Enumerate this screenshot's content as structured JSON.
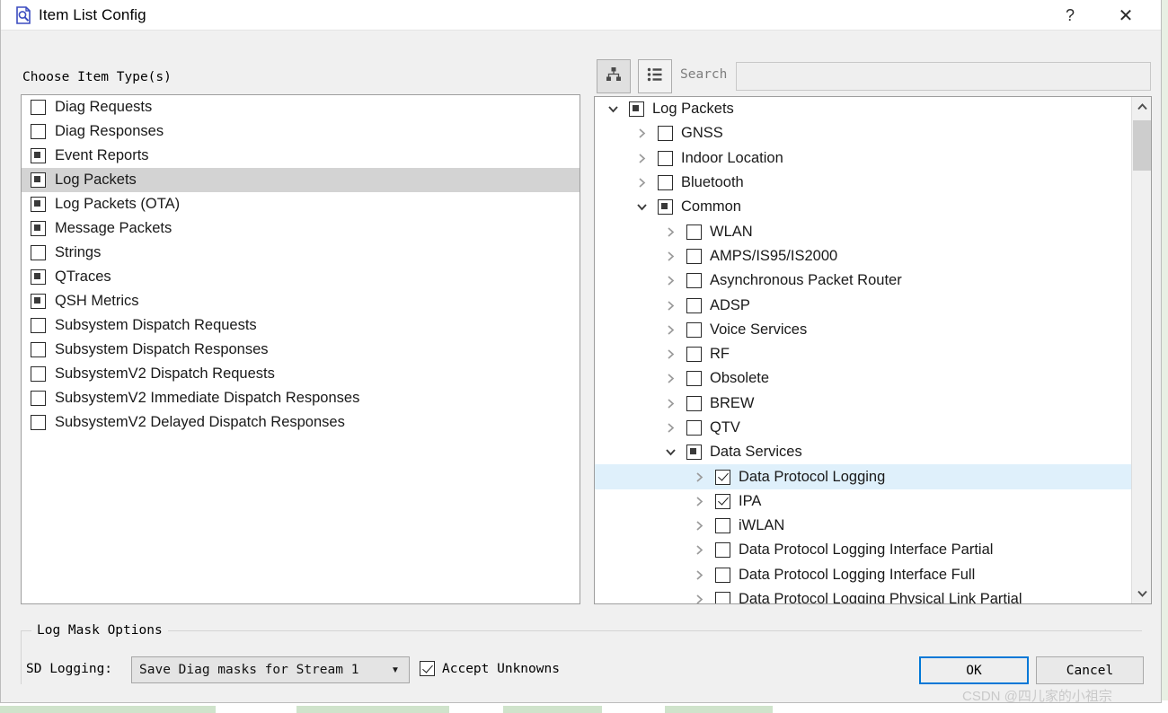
{
  "window": {
    "title": "Item List Config",
    "icon": "document-search-icon",
    "help_label": "?",
    "close_label": "✕"
  },
  "left_panel": {
    "group_label": "Choose Item Type(s)",
    "items": [
      {
        "label": "Diag Requests",
        "state": "unchecked",
        "selected": false
      },
      {
        "label": "Diag Responses",
        "state": "unchecked",
        "selected": false
      },
      {
        "label": "Event Reports",
        "state": "partial",
        "selected": false
      },
      {
        "label": "Log Packets",
        "state": "partial",
        "selected": true
      },
      {
        "label": "Log Packets (OTA)",
        "state": "partial",
        "selected": false
      },
      {
        "label": "Message Packets",
        "state": "partial",
        "selected": false
      },
      {
        "label": "Strings",
        "state": "unchecked",
        "selected": false
      },
      {
        "label": "QTraces",
        "state": "partial",
        "selected": false
      },
      {
        "label": "QSH Metrics",
        "state": "partial",
        "selected": false
      },
      {
        "label": "Subsystem Dispatch Requests",
        "state": "unchecked",
        "selected": false
      },
      {
        "label": "Subsystem Dispatch Responses",
        "state": "unchecked",
        "selected": false
      },
      {
        "label": "SubsystemV2 Dispatch Requests",
        "state": "unchecked",
        "selected": false
      },
      {
        "label": "SubsystemV2 Immediate Dispatch Responses",
        "state": "unchecked",
        "selected": false
      },
      {
        "label": "SubsystemV2 Delayed Dispatch Responses",
        "state": "unchecked",
        "selected": false
      }
    ]
  },
  "right_panel": {
    "toolbar": {
      "tree_view_icon": "hierarchy-icon",
      "list_view_icon": "bulleted-list-icon",
      "search_label": "Search",
      "search_value": "",
      "search_placeholder": ""
    },
    "tree": [
      {
        "label": "Log Packets",
        "state": "partial",
        "depth": 0,
        "expander": "open",
        "selected": false
      },
      {
        "label": "GNSS",
        "state": "unchecked",
        "depth": 1,
        "expander": "closed",
        "selected": false
      },
      {
        "label": "Indoor Location",
        "state": "unchecked",
        "depth": 1,
        "expander": "closed",
        "selected": false
      },
      {
        "label": "Bluetooth",
        "state": "unchecked",
        "depth": 1,
        "expander": "closed",
        "selected": false
      },
      {
        "label": "Common",
        "state": "partial",
        "depth": 1,
        "expander": "open",
        "selected": false
      },
      {
        "label": "WLAN",
        "state": "unchecked",
        "depth": 2,
        "expander": "closed",
        "selected": false
      },
      {
        "label": "AMPS/IS95/IS2000",
        "state": "unchecked",
        "depth": 2,
        "expander": "closed",
        "selected": false
      },
      {
        "label": "Asynchronous Packet Router",
        "state": "unchecked",
        "depth": 2,
        "expander": "closed",
        "selected": false
      },
      {
        "label": "ADSP",
        "state": "unchecked",
        "depth": 2,
        "expander": "closed",
        "selected": false
      },
      {
        "label": "Voice Services",
        "state": "unchecked",
        "depth": 2,
        "expander": "closed",
        "selected": false
      },
      {
        "label": "RF",
        "state": "unchecked",
        "depth": 2,
        "expander": "closed",
        "selected": false
      },
      {
        "label": "Obsolete",
        "state": "unchecked",
        "depth": 2,
        "expander": "closed",
        "selected": false
      },
      {
        "label": "BREW",
        "state": "unchecked",
        "depth": 2,
        "expander": "closed",
        "selected": false
      },
      {
        "label": "QTV",
        "state": "unchecked",
        "depth": 2,
        "expander": "closed",
        "selected": false
      },
      {
        "label": "Data Services",
        "state": "partial",
        "depth": 2,
        "expander": "open",
        "selected": false
      },
      {
        "label": "Data Protocol Logging",
        "state": "checked",
        "depth": 3,
        "expander": "closed",
        "selected": true
      },
      {
        "label": "IPA",
        "state": "checked",
        "depth": 3,
        "expander": "closed",
        "selected": false
      },
      {
        "label": "iWLAN",
        "state": "unchecked",
        "depth": 3,
        "expander": "closed",
        "selected": false
      },
      {
        "label": "Data Protocol Logging Interface Partial",
        "state": "unchecked",
        "depth": 3,
        "expander": "closed",
        "selected": false
      },
      {
        "label": "Data Protocol Logging Interface Full",
        "state": "unchecked",
        "depth": 3,
        "expander": "closed",
        "selected": false
      },
      {
        "label": "Data Protocol Logging Physical Link Partial",
        "state": "unchecked",
        "depth": 3,
        "expander": "closed",
        "selected": false
      }
    ],
    "scrollbar": {
      "up_arrow": "⌃",
      "down_arrow": "⌄"
    }
  },
  "log_mask_options": {
    "group_title": "Log Mask Options",
    "sd_logging_label": "SD Logging:",
    "sd_logging_value": "Save Diag masks for Stream 1",
    "sd_logging_options": [
      "Save Diag masks for Stream 1"
    ],
    "accept_unknowns_label": "Accept Unknowns",
    "accept_unknowns_checked": true
  },
  "buttons": {
    "ok": "OK",
    "cancel": "Cancel"
  },
  "watermark": "CSDN @四儿家的小祖宗",
  "colors": {
    "dialog_bg": "#f0f0f0",
    "selection_left": "#d3d3d3",
    "selection_tree": "#dff0fb",
    "focus_border": "#0078d7",
    "desktop": "#cfe3cb"
  }
}
